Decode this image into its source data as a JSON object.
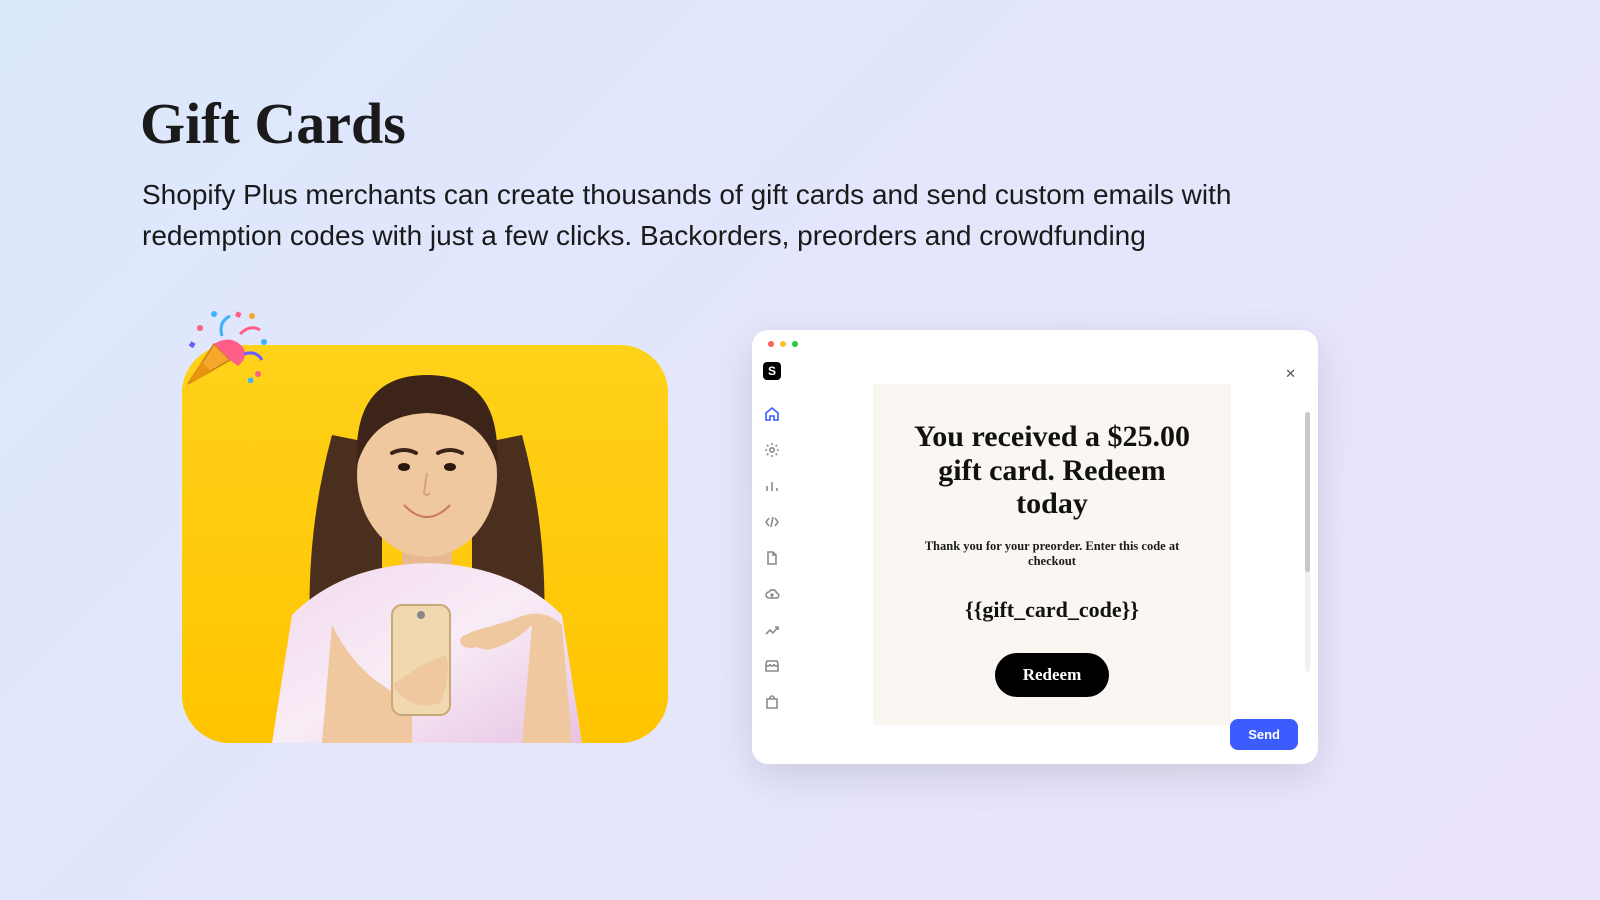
{
  "page": {
    "title": "Gift Cards",
    "subtitle": "Shopify Plus merchants can create thousands of gift cards and send custom emails with redemption codes with just a few clicks. Backorders, preorders and crowdfunding"
  },
  "sidebar": {
    "logo_letter": "S",
    "items": [
      {
        "name": "home-icon",
        "active": true
      },
      {
        "name": "gear-icon",
        "active": false
      },
      {
        "name": "chart-icon",
        "active": false
      },
      {
        "name": "code-icon",
        "active": false
      },
      {
        "name": "file-icon",
        "active": false
      },
      {
        "name": "cloud-icon",
        "active": false
      },
      {
        "name": "trend-icon",
        "active": false
      },
      {
        "name": "store-icon",
        "active": false
      },
      {
        "name": "bag-icon",
        "active": false
      }
    ]
  },
  "email_preview": {
    "title": "You received a $25.00 gift card. Redeem today",
    "subtitle": "Thank you for your preorder. Enter this code at checkout",
    "code_placeholder": "{{gift_card_code}}",
    "redeem_label": "Redeem"
  },
  "actions": {
    "send_label": "Send",
    "close_glyph": "✕"
  }
}
